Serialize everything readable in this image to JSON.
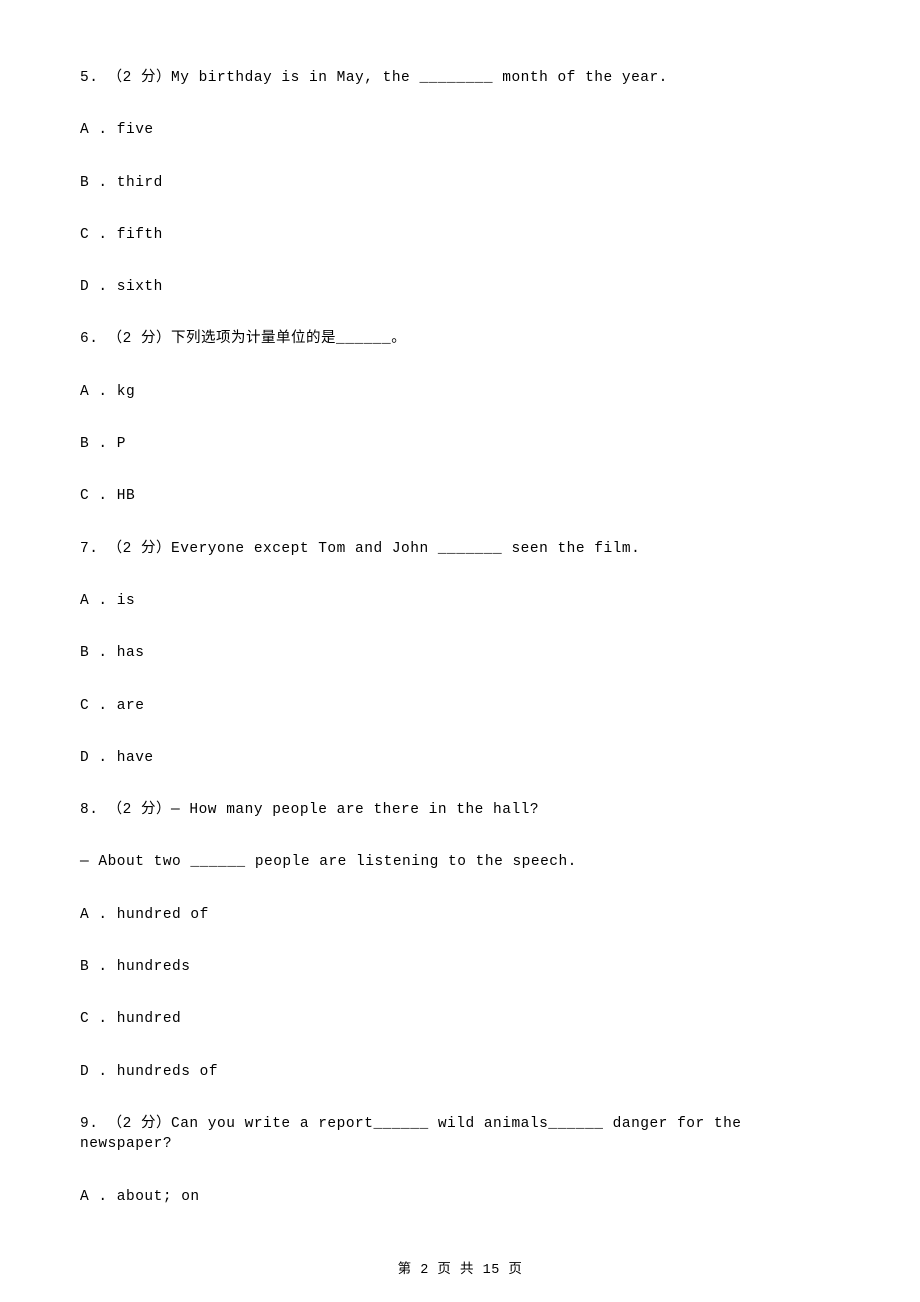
{
  "questions": [
    {
      "stem_lines": [
        "5. （2 分）My birthday is in May, the ________ month of the year."
      ],
      "options": [
        "A . five",
        "B . third",
        "C . fifth",
        "D . sixth"
      ]
    },
    {
      "stem_lines": [
        "6. （2 分）下列选项为计量单位的是______。"
      ],
      "options": [
        "A . kg",
        "B . P",
        "C . HB"
      ]
    },
    {
      "stem_lines": [
        "7. （2 分）Everyone except Tom and John _______ seen the film."
      ],
      "options": [
        "A . is",
        "B . has",
        "C . are",
        "D . have"
      ]
    },
    {
      "stem_lines": [
        "8. （2 分）— How many people are there in the hall?",
        "— About two ______ people are listening to the speech."
      ],
      "options": [
        "A . hundred of",
        "B . hundreds",
        "C . hundred",
        "D . hundreds of"
      ]
    },
    {
      "stem_lines": [
        "9. （2 分）Can you write a report______ wild animals______ danger for the newspaper?"
      ],
      "options": [
        "A . about; on"
      ]
    }
  ],
  "footer": "第 2 页 共 15 页"
}
